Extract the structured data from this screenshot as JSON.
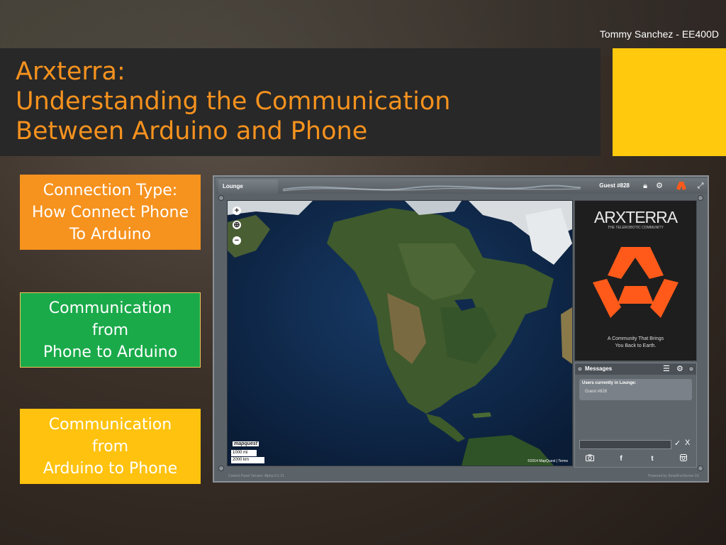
{
  "slide": {
    "author": "Tommy Sanchez - EE400D",
    "title_lines": [
      "Arxterra:",
      "Understanding the Communication",
      "Between Arduino and Phone"
    ],
    "cards": [
      {
        "text": "Connection Type:\nHow Connect Phone\nTo Arduino",
        "color": "#f6921e"
      },
      {
        "text": "Communication\nfrom\nPhone to Arduino",
        "color": "#1aaa4a"
      },
      {
        "text": "Communication\nfrom\nArduino to Phone",
        "color": "#ffc20e"
      }
    ],
    "accent_color": "#ffc90e",
    "title_color": "#f6921e"
  },
  "app": {
    "tab_label": "Lounge",
    "guest_label": "Guest #828",
    "map": {
      "zoom_in": "+",
      "zoom_fit": "⊕",
      "zoom_out": "−",
      "provider_logo": "mapquest",
      "scale_miles": "1000 mi",
      "scale_km": "2000 km",
      "copyright": "©2014 MapQuest | Terms"
    },
    "brand": {
      "title": "ARXTERRA",
      "subtitle": "THE TELEROBOTIC COMMUNITY",
      "tagline": "A Community That Brings\nYou Back to Earth."
    },
    "messages": {
      "title": "Messages",
      "users_heading": "Users currently in Lounge:",
      "users": [
        "Guest #828"
      ],
      "input_value": "",
      "send_glyph": "✓",
      "close_glyph": "X"
    },
    "social_icons": [
      "camera-icon",
      "facebook-icon",
      "twitter-icon",
      "instagram-icon"
    ],
    "footer_left": "Control Panel Version: Alpha 0.1.21",
    "footer_right": "Powered by SmartFoxServer 2X"
  }
}
